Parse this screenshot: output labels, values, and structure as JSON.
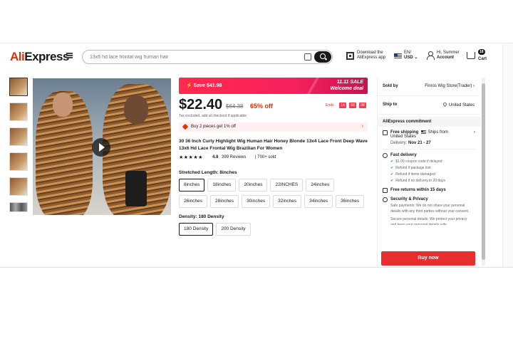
{
  "header": {
    "logo_ali": "Ali",
    "logo_express": "Express",
    "search_placeholder": "13x6 hd lace frontal wig human hair",
    "download_line1": "Download the",
    "download_line2": "AliExpress app",
    "lang_line1": "EN/",
    "lang_line2": "USD ⌄",
    "account_line1": "Hi, Summer",
    "account_line2": "Account",
    "cart_count": "18",
    "cart_label": "Cart"
  },
  "product": {
    "save_text": "⚡ Save $41.98",
    "sale_line1": "11.11 SALE",
    "sale_line2": "Welcome deal",
    "price": "$22.40",
    "original_price": "$64.38",
    "discount": "65% off",
    "ends_label": "Ends",
    "timer": [
      "14",
      "58",
      "08"
    ],
    "tax_note": "Tax excluded, add at checkout if applicable",
    "bundle_text": "Buy 2 pieces get 1% off",
    "title": "30 36 Inch Curly Highlight Wig Human Hair Honey Blonde 13x4 Lace Front Deep Wave 13x6 Hd Lace Frontal Wig Brazilian For Women",
    "stars": "★★★★★",
    "rating": "4.8",
    "reviews": "399 Reviews",
    "sold": "| 700+ sold",
    "length_label": "Stretched Length: 8inches",
    "lengths": [
      "8inches",
      "18inches",
      "20inches",
      "22INCHES",
      "24inches",
      "26inches",
      "28inches",
      "30inches",
      "32inches",
      "34inches",
      "36inches"
    ],
    "density_label": "Density: 180 Density",
    "densities": [
      "180 Density",
      "200 Density"
    ]
  },
  "panel": {
    "sold_by_label": "Sold by",
    "sold_by_value": "Finros Wig Store(Trader) ›",
    "ship_to_label": "Ship to",
    "ship_to_value": "United States",
    "commitment": "AliExpress commitment",
    "free_shipping": "Free shipping",
    "ships_from": "Ships from",
    "ships_from_country": "United States",
    "delivery_label": "Delivery:",
    "delivery_dates": "Nov 21 - 27",
    "fast_delivery": "Fast delivery",
    "fast_items": [
      "$1.00 coupon code if delayed",
      "Refund if package lost",
      "Refund if items damaged",
      "Refund if no delivery in 20 days"
    ],
    "free_returns": "Free returns within 15 days",
    "security": "Security & Privacy",
    "security_text1": "Safe payments: We do not share your personal details with any third parties without your consent.",
    "security_text2": "Secure personal details: We protect your privacy and keep your personal details safe",
    "buy_now": "Buy now"
  }
}
